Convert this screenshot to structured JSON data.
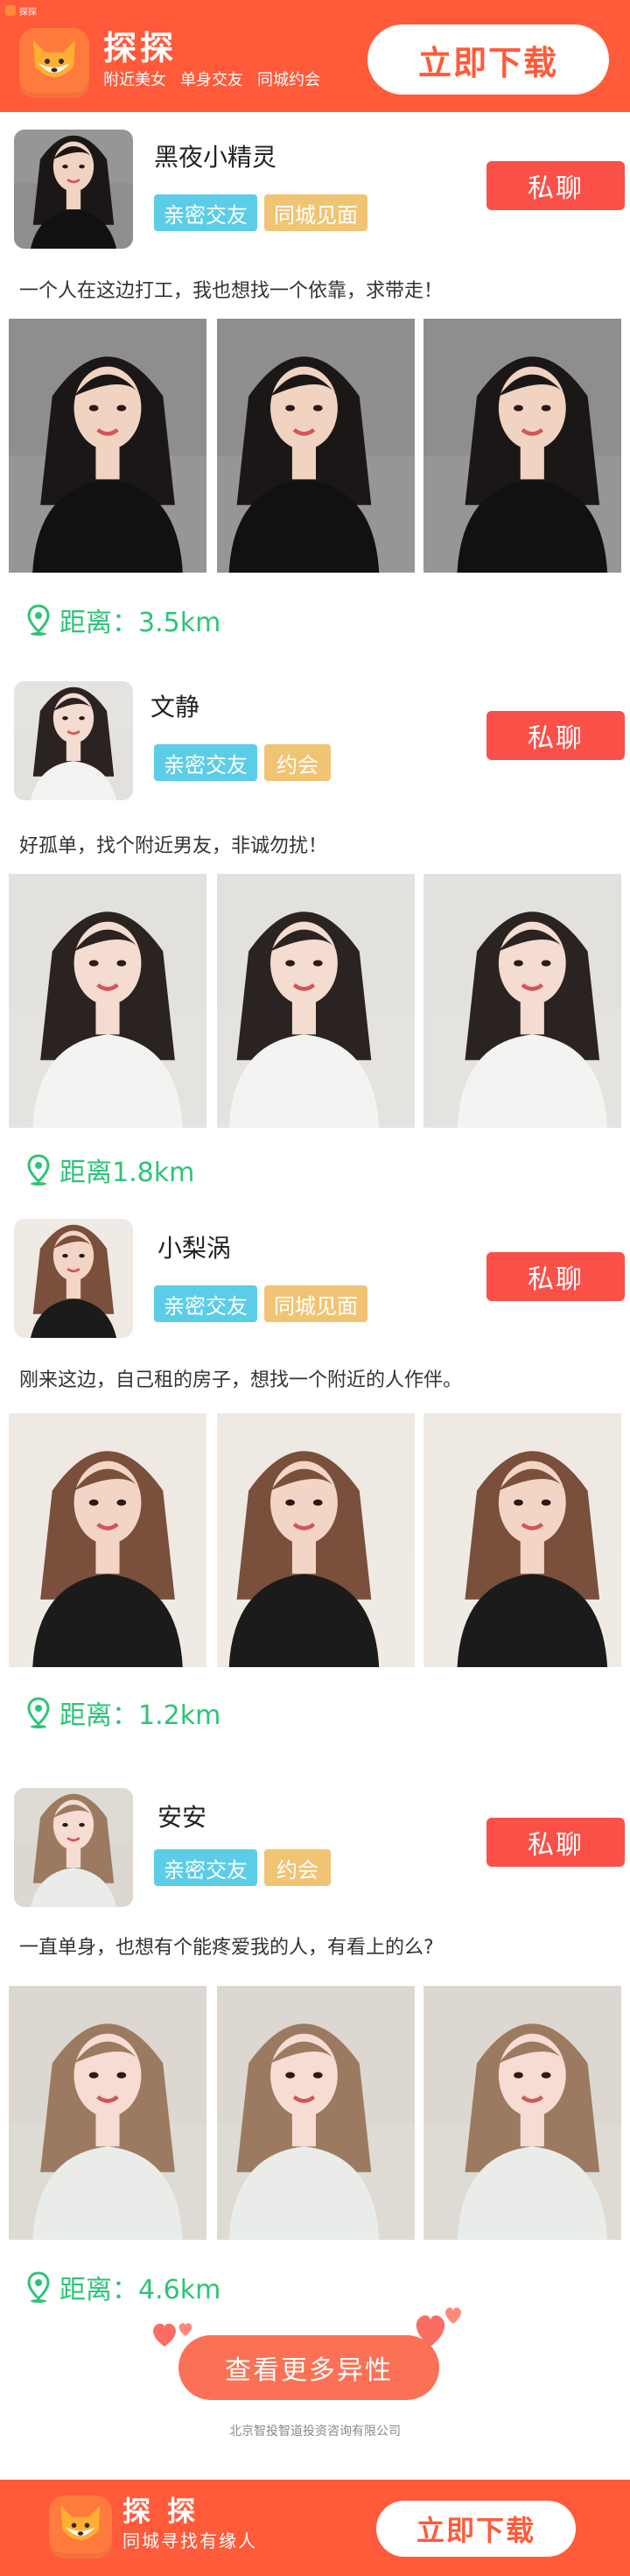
{
  "status_bar": {
    "app": "探探"
  },
  "header": {
    "brand": "探探",
    "tags": [
      "附近美女",
      "单身交友",
      "同城约会"
    ],
    "download": "立即下载"
  },
  "profiles": [
    {
      "name": "黑夜小精灵",
      "tags": [
        "亲密交友",
        "同城见面"
      ],
      "bio": "一个人在这边打工，我也想找一个依靠，求带走！",
      "distance": "距离：3.5km",
      "message": "私聊",
      "skin": "#f1d3c1",
      "hair": "#1c1717",
      "outfit": "#111111",
      "bg": "#8e8e8e"
    },
    {
      "name": "文静",
      "tags": [
        "亲密交友",
        "约会"
      ],
      "bio": "好孤单，找个附近男友，非诚勿扰！",
      "distance": "距离1.8km",
      "message": "私聊",
      "skin": "#f4dcd1",
      "hair": "#2a2322",
      "outfit": "#f3f3f1",
      "bg": "#e3e1dd"
    },
    {
      "name": "小梨涡",
      "tags": [
        "亲密交友",
        "同城见面"
      ],
      "bio": "刚来这边，自己租的房子，想找一个附近的人作伴。",
      "distance": "距离：1.2km",
      "message": "私聊",
      "skin": "#f3d5c6",
      "hair": "#7a4f3b",
      "outfit": "#1b1b1b",
      "bg": "#efe9e3"
    },
    {
      "name": "安安",
      "tags": [
        "亲密交友",
        "约会"
      ],
      "bio": "一直单身，也想有个能疼爱我的人，有看上的么?",
      "distance": "距离：4.6km",
      "message": "私聊",
      "skin": "#f6dcd3",
      "hair": "#9c7a61",
      "outfit": "#e9ece9",
      "bg": "#dcd7d1"
    }
  ],
  "footer": {
    "more": "查看更多异性",
    "company": "北京智投智道投资咨询有限公司",
    "brand": "探 探",
    "slogan": "同城寻找有缘人",
    "download": "立即下载"
  },
  "colors": {
    "brand": "#ff5a3a",
    "message_button": "#fa5048",
    "tag_blue": "#5ccde6",
    "tag_orange": "#f1c474",
    "distance": "#2dc477"
  }
}
